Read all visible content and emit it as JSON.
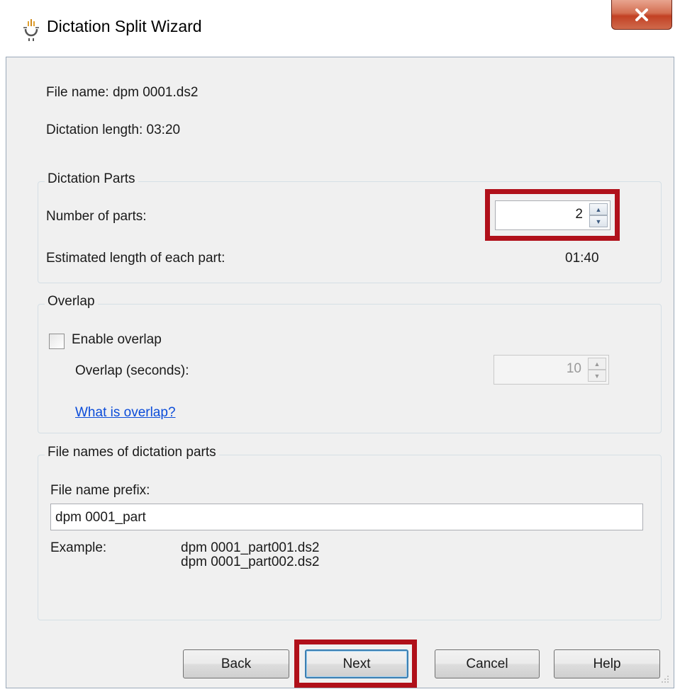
{
  "window": {
    "title": "Dictation Split Wizard"
  },
  "info": {
    "file_name": "File name: dpm 0001.ds2",
    "dictation_length": "Dictation length: 03:20"
  },
  "parts_group": {
    "title": "Dictation Parts",
    "number_label": "Number of parts:",
    "number_value": "2",
    "estimated_label": "Estimated length of each part:",
    "estimated_value": "01:40"
  },
  "overlap_group": {
    "title": "Overlap",
    "enable_label": "Enable overlap",
    "enable_checked": false,
    "seconds_label": "Overlap (seconds):",
    "seconds_value": "10",
    "help_link": "What is overlap?"
  },
  "filenames_group": {
    "title": "File names of dictation parts",
    "prefix_label": "File name prefix:",
    "prefix_value": "dpm 0001_part",
    "example_label": "Example:",
    "examples": [
      "dpm 0001_part001.ds2",
      "dpm 0001_part002.ds2"
    ]
  },
  "buttons": {
    "back": "Back",
    "next": "Next",
    "cancel": "Cancel",
    "help": "Help"
  },
  "colors": {
    "highlight": "#b0101a",
    "link": "#0b4cd9",
    "close_button": "#c24124"
  }
}
